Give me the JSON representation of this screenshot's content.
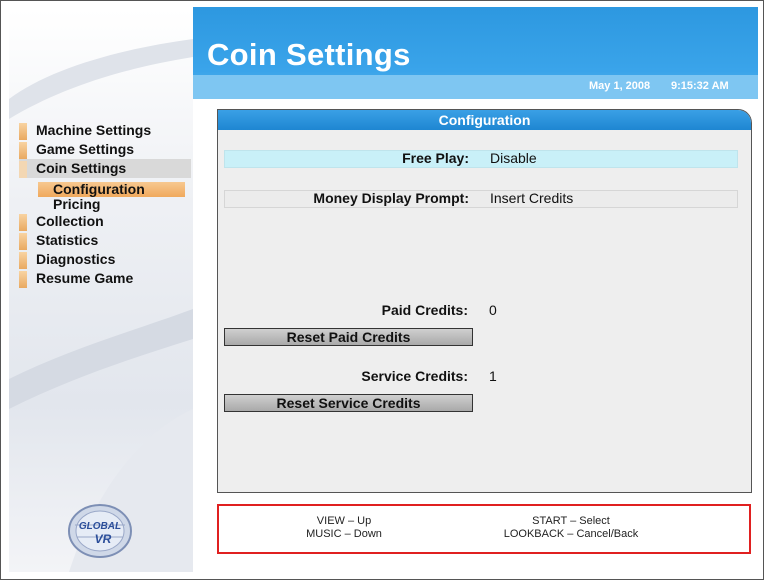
{
  "header": {
    "title": "Coin Settings",
    "date": "May 1, 2008",
    "time": "9:15:32 AM"
  },
  "sidebar": {
    "items": [
      {
        "label": "Machine Settings"
      },
      {
        "label": "Game Settings"
      },
      {
        "label": "Coin Settings"
      },
      {
        "label": "Collection"
      },
      {
        "label": "Statistics"
      },
      {
        "label": "Diagnostics"
      },
      {
        "label": "Resume Game"
      }
    ],
    "subitems": [
      {
        "label": "Configuration"
      },
      {
        "label": "Pricing"
      }
    ],
    "logo_text": "GLOBAL VR"
  },
  "panel": {
    "title": "Configuration",
    "free_play": {
      "label": "Free Play:",
      "value": "Disable"
    },
    "money_prompt": {
      "label": "Money Display Prompt:",
      "value": "Insert Credits"
    },
    "paid_credits": {
      "label": "Paid Credits:",
      "value": "0"
    },
    "reset_paid": "Reset Paid Credits",
    "service_credits": {
      "label": "Service Credits:",
      "value": "1"
    },
    "reset_service": "Reset Service Credits"
  },
  "footer": {
    "view": "VIEW – Up",
    "music": "MUSIC – Down",
    "start": "START – Select",
    "lookback": "LOOKBACK – Cancel/Back"
  },
  "colors": {
    "header_blue": "#2d98e0",
    "free_play_highlight": "#c9f0f8",
    "nav_tab_orange": "#f0a95c",
    "footer_border": "#e02020"
  }
}
